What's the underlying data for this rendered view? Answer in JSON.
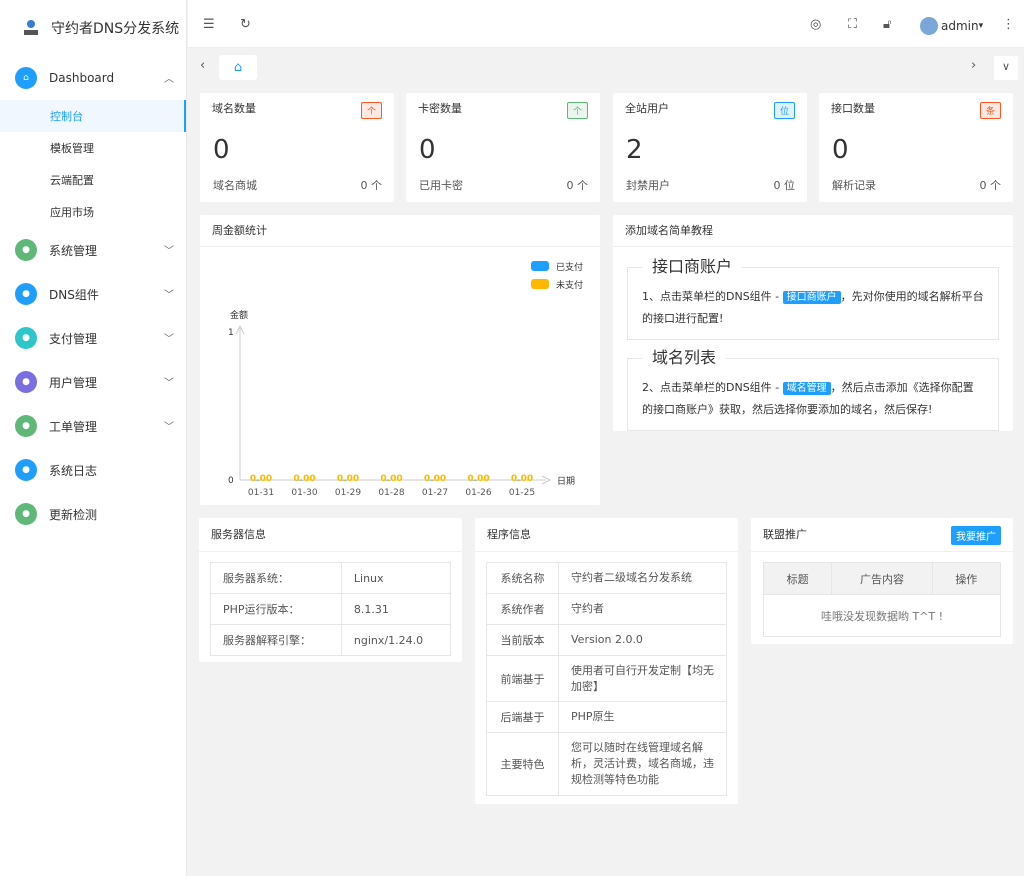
{
  "app": {
    "title": "守约者DNS分发系统"
  },
  "sidebar": {
    "dashboard": "Dashboard",
    "subs": [
      "控制台",
      "模板管理",
      "云端配置",
      "应用市场"
    ],
    "items": [
      {
        "label": "系统管理",
        "icon": "gear-icon",
        "color": "#5fb878"
      },
      {
        "label": "DNS组件",
        "icon": "dns-icon",
        "color": "#1e9fff"
      },
      {
        "label": "支付管理",
        "icon": "pay-icon",
        "color": "#2ec7c9"
      },
      {
        "label": "用户管理",
        "icon": "user-icon",
        "color": "#7a6fe0"
      },
      {
        "label": "工单管理",
        "icon": "ticket-icon",
        "color": "#5fb878"
      },
      {
        "label": "系统日志",
        "icon": "log-icon",
        "color": "#1e9fff"
      },
      {
        "label": "更新检测",
        "icon": "update-icon",
        "color": "#5fb878"
      }
    ]
  },
  "header": {
    "user": "admin"
  },
  "stats": [
    {
      "title": "域名数量",
      "badge": "个",
      "badge_color": "#ff5722",
      "value": "0",
      "sub_label": "域名商城",
      "sub_value": "0 个"
    },
    {
      "title": "卡密数量",
      "badge": "个",
      "badge_color": "#5fb878",
      "value": "0",
      "sub_label": "已用卡密",
      "sub_value": "0 个"
    },
    {
      "title": "全站用户",
      "badge": "位",
      "badge_color": "#1e9fff",
      "value": "2",
      "sub_label": "封禁用户",
      "sub_value": "0 位"
    },
    {
      "title": "接口数量",
      "badge": "条",
      "badge_color": "#ff5722",
      "value": "0",
      "sub_label": "解析记录",
      "sub_value": "0 个"
    }
  ],
  "chart_panel": {
    "title": "周金额统计"
  },
  "chart_data": {
    "type": "bar",
    "categories": [
      "01-31",
      "01-30",
      "01-29",
      "01-28",
      "01-27",
      "01-26",
      "01-25"
    ],
    "series": [
      {
        "name": "已支付",
        "color": "#1e9fff",
        "values": [
          0,
          0,
          0,
          0,
          0,
          0,
          0
        ]
      },
      {
        "name": "未支付",
        "color": "#ffb800",
        "values": [
          0,
          0,
          0,
          0,
          0,
          0,
          0
        ]
      }
    ],
    "data_labels": [
      "0.00",
      "0.00",
      "0.00",
      "0.00",
      "0.00",
      "0.00",
      "0.00"
    ],
    "ylabel": "金额",
    "xlabel": "日期",
    "yticks": [
      "0",
      "1"
    ],
    "ylim": [
      0,
      1
    ],
    "legend": "top-right"
  },
  "tutorial": {
    "title": "添加域名简单教程",
    "s1": {
      "legend": "接口商账户",
      "pre": "1、点击菜单栏的DNS组件 - ",
      "tag": "接口商账户",
      "post": "，先对你使用的域名解析平台的接口进行配置!"
    },
    "s2": {
      "legend": "域名列表",
      "pre": "2、点击菜单栏的DNS组件 - ",
      "tag": "域名管理",
      "post": "，然后点击添加《选择你配置的接口商账户》获取，然后选择你要添加的域名，然后保存!"
    }
  },
  "server": {
    "title": "服务器信息",
    "rows": [
      [
        "服务器系统：",
        "Linux"
      ],
      [
        "PHP运行版本：",
        "8.1.31"
      ],
      [
        "服务器解释引擎：",
        "nginx/1.24.0"
      ]
    ]
  },
  "program": {
    "title": "程序信息",
    "rows": [
      [
        "系统名称",
        "守约者二级域名分发系统"
      ],
      [
        "系统作者",
        "守约者"
      ],
      [
        "当前版本",
        "Version 2.0.0"
      ],
      [
        "前端基于",
        "使用者可自行开发定制【均无加密】"
      ],
      [
        "后端基于",
        "PHP原生"
      ],
      [
        "主要特色",
        "您可以随时在线管理域名解析，灵活计费，域名商城，违规检测等特色功能"
      ]
    ]
  },
  "promo": {
    "title": "联盟推广",
    "button": "我要推广",
    "cols": [
      "标题",
      "广告内容",
      "操作"
    ],
    "empty": "哇哦没发现数据哟 T^T !"
  }
}
